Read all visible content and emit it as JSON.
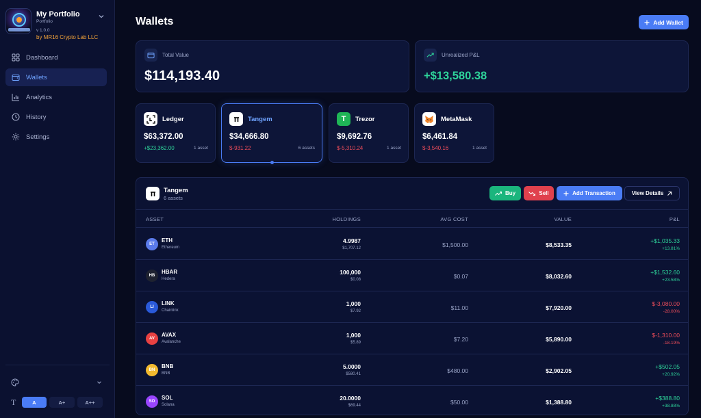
{
  "brand": {
    "title": "My Portfolio",
    "subtitle": "Portfolio",
    "version": "v 1.0.0",
    "by": "by MR16 Crypto Lab LLC"
  },
  "nav": [
    {
      "label": "Dashboard",
      "icon": "dashboard-icon",
      "active": false
    },
    {
      "label": "Wallets",
      "icon": "wallet-icon",
      "active": true
    },
    {
      "label": "Analytics",
      "icon": "chart-icon",
      "active": false
    },
    {
      "label": "History",
      "icon": "clock-icon",
      "active": false
    },
    {
      "label": "Settings",
      "icon": "gear-icon",
      "active": false
    }
  ],
  "font_sizes": {
    "small": "A",
    "medium": "A+",
    "large": "A++"
  },
  "page": {
    "title": "Wallets",
    "add_wallet_label": "Add Wallet"
  },
  "stats": {
    "total_value_label": "Total Value",
    "total_value": "$114,193.40",
    "unrealized_label": "Unrealized P&L",
    "unrealized": "+$13,580.38"
  },
  "wallets": [
    {
      "name": "Ledger",
      "value": "$63,372.00",
      "pnl": "+$23,362.00",
      "assets": "1 asset",
      "icon": "ledger-icon"
    },
    {
      "name": "Tangem",
      "value": "$34,666.80",
      "pnl": "$-931.22",
      "assets": "6 assets",
      "icon": "tangem-icon"
    },
    {
      "name": "Trezor",
      "value": "$9,692.76",
      "pnl": "$-5,310.24",
      "assets": "1 asset",
      "icon": "trezor-icon",
      "icon_letter": "T"
    },
    {
      "name": "MetaMask",
      "value": "$6,461.84",
      "pnl": "$-3,540.16",
      "assets": "1 asset",
      "icon": "metamask-fox-icon"
    }
  ],
  "detail": {
    "title": "Tangem",
    "subtitle": "6 assets",
    "buy_label": "Buy",
    "sell_label": "Sell",
    "add_tx_label": "Add Transaction",
    "view_label": "View Details",
    "columns": [
      "ASSET",
      "HOLDINGS",
      "AVG COST",
      "VALUE",
      "P&L"
    ],
    "rows": [
      {
        "badge": "ET",
        "symbol": "ETH",
        "name": "Ethereum",
        "holdings": "4.9987",
        "holdings_value": "$1,707.12",
        "avg_cost": "$1,500.00",
        "value": "$8,533.35",
        "pnl": "+$1,035.33",
        "pnl_pct": "+13.81%",
        "color": "#5b7bea"
      },
      {
        "badge": "HB",
        "symbol": "HBAR",
        "name": "Hedera",
        "holdings": "100,000",
        "holdings_value": "$0.08",
        "avg_cost": "$0.07",
        "value": "$8,032.60",
        "pnl": "+$1,532.60",
        "pnl_pct": "+23.58%",
        "color": "#1e2230"
      },
      {
        "badge": "LI",
        "symbol": "LINK",
        "name": "Chainlink",
        "holdings": "1,000",
        "holdings_value": "$7.92",
        "avg_cost": "$11.00",
        "value": "$7,920.00",
        "pnl": "$-3,080.00",
        "pnl_pct": "-28.00%",
        "color": "#2a5ada"
      },
      {
        "badge": "AV",
        "symbol": "AVAX",
        "name": "Avalanche",
        "holdings": "1,000",
        "holdings_value": "$5.89",
        "avg_cost": "$7.20",
        "value": "$5,890.00",
        "pnl": "$-1,310.00",
        "pnl_pct": "-18.19%",
        "color": "#e84142"
      },
      {
        "badge": "BN",
        "symbol": "BNB",
        "name": "BNB",
        "holdings": "5.0000",
        "holdings_value": "$580.41",
        "avg_cost": "$480.00",
        "value": "$2,902.05",
        "pnl": "+$502.05",
        "pnl_pct": "+20.92%",
        "color": "#f3ba2f"
      },
      {
        "badge": "SO",
        "symbol": "SOL",
        "name": "Solana",
        "holdings": "20.0000",
        "holdings_value": "$69.44",
        "avg_cost": "$50.00",
        "value": "$1,388.80",
        "pnl": "+$388.80",
        "pnl_pct": "+38.88%",
        "color": "#9945ff"
      }
    ]
  },
  "colors": {
    "accent": "#4a7cf5",
    "positive": "#2ed39a",
    "negative": "#ef4d5a",
    "background": "#070b1e"
  }
}
